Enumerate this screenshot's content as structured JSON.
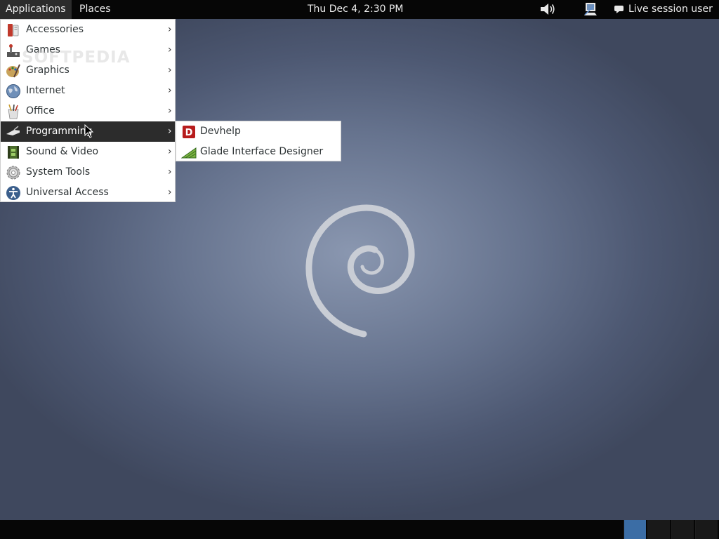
{
  "top_panel": {
    "applications_label": "Applications",
    "places_label": "Places",
    "clock": "Thu Dec  4,  2:30 PM",
    "user_label": "Live session user"
  },
  "apps_menu": {
    "items": [
      {
        "label": "Accessories",
        "icon": "accessories-icon",
        "arrow": "›"
      },
      {
        "label": "Games",
        "icon": "games-icon",
        "arrow": "›"
      },
      {
        "label": "Graphics",
        "icon": "graphics-icon",
        "arrow": "›"
      },
      {
        "label": "Internet",
        "icon": "internet-icon",
        "arrow": "›"
      },
      {
        "label": "Office",
        "icon": "office-icon",
        "arrow": "›"
      },
      {
        "label": "Programming",
        "icon": "programming-icon",
        "arrow": "›",
        "active": true
      },
      {
        "label": "Sound & Video",
        "icon": "sound-video-icon",
        "arrow": "›"
      },
      {
        "label": "System Tools",
        "icon": "system-tools-icon",
        "arrow": "›"
      },
      {
        "label": "Universal Access",
        "icon": "universal-access-icon",
        "arrow": "›"
      }
    ]
  },
  "programming_submenu": {
    "items": [
      {
        "label": "Devhelp",
        "icon": "devhelp-icon"
      },
      {
        "label": "Glade Interface Designer",
        "icon": "glade-icon"
      }
    ]
  },
  "watermark": "SOFTPEDIA",
  "workspaces": {
    "count": 4,
    "active_index": 0
  },
  "colors": {
    "panel": "#060606",
    "menu_highlight": "#2c2c2c",
    "workspace_active": "#3b6da5",
    "desktop_center": "#8a97b0",
    "desktop_edge": "#3f485e"
  }
}
